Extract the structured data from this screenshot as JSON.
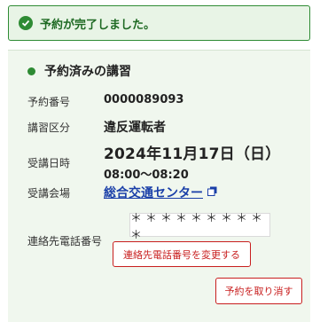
{
  "alert": {
    "message": "予約が完了しました。",
    "icon": "check-circle-icon"
  },
  "reservation": {
    "title": "予約済みの講習",
    "number_label": "予約番号",
    "number": "0000089093",
    "course_label": "講習区分",
    "course": "違反運転者",
    "datetime_label": "受講日時",
    "date": "2024年11月17日（日）",
    "time": "08:00〜08:20",
    "venue_label": "受講会場",
    "venue": "総合交通センター",
    "phone_label": "連絡先電話番号",
    "phone_masked": "＊＊＊＊＊＊＊＊＊＊",
    "change_phone_button": "連絡先電話番号を変更する",
    "cancel_button": "予約を取り消す"
  },
  "colors": {
    "success": "#2e8b34",
    "success_bg": "#e8f4e6",
    "card_bg": "#f0f7ee",
    "link": "#1a3fa8",
    "danger": "#c81e1e"
  }
}
